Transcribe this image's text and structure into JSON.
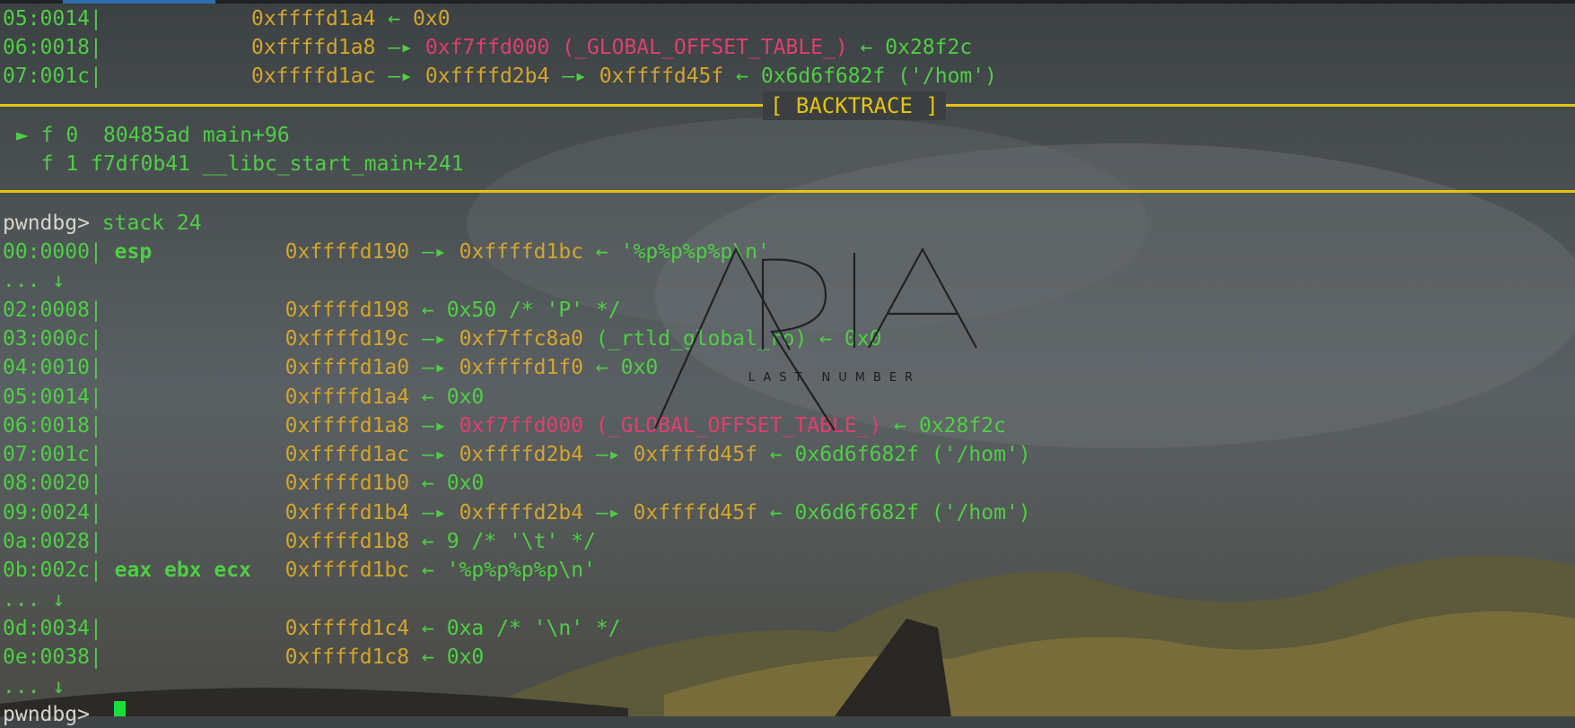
{
  "colors": {
    "background": "#3f4447",
    "offset_green": "#4ecf44",
    "address_yellow": "#d3a52e",
    "got_pink": "#df3f6e",
    "rule_yellow": "#e6c40a",
    "cursor_green": "#19e13a"
  },
  "top_telescope": [
    {
      "off": "05:0014",
      "addr": "0xffffd1a4",
      "a1": "←",
      "v1": "0x0"
    },
    {
      "off": "06:0018",
      "addr": "0xffffd1a8",
      "a1": "—▸",
      "v1": "0xf7ffd000",
      "v2": "(_GLOBAL_OFFSET_TABLE_)",
      "a2": "←",
      "v3": "0x28f2c"
    },
    {
      "off": "07:001c",
      "addr": "0xffffd1ac",
      "a1": "—▸",
      "v1": "0xffffd2b4",
      "a2": "—▸",
      "v2": "0xffffd45f",
      "a3": "←",
      "v3": "0x6d6f682f",
      "v4": "('/hom')"
    }
  ],
  "backtrace": {
    "label": "[ BACKTRACE ]",
    "frames": [
      {
        "marker": "►",
        "frame": "f 0",
        "addr": "80485ad",
        "sym": "main+96"
      },
      {
        "marker": "",
        "frame": "f 1",
        "addr": "f7df0b41",
        "sym": "__libc_start_main+241"
      }
    ]
  },
  "command": {
    "prompt": "pwndbg>",
    "text": "stack 24"
  },
  "stack": [
    {
      "off": "00:0000",
      "reg": "esp",
      "addr": "0xffffd190",
      "a1": "—▸",
      "v1": "0xffffd1bc",
      "a2": "←",
      "v2": "'%p%p%p%p\\n'"
    },
    {
      "skip": "... ↓"
    },
    {
      "off": "02:0008",
      "reg": "",
      "addr": "0xffffd198",
      "a1": "←",
      "v1": "0x50 /* 'P' */"
    },
    {
      "off": "03:000c",
      "reg": "",
      "addr": "0xffffd19c",
      "a1": "—▸",
      "v1": "0xf7ffc8a0",
      "v2": "(_rtld_global_ro)",
      "a2": "←",
      "v3": "0x0"
    },
    {
      "off": "04:0010",
      "reg": "",
      "addr": "0xffffd1a0",
      "a1": "—▸",
      "v1": "0xffffd1f0",
      "a2": "←",
      "v2": "0x0"
    },
    {
      "off": "05:0014",
      "reg": "",
      "addr": "0xffffd1a4",
      "a1": "←",
      "v1": "0x0"
    },
    {
      "off": "06:0018",
      "reg": "",
      "addr": "0xffffd1a8",
      "a1": "—▸",
      "v1": "0xf7ffd000",
      "v2": "(_GLOBAL_OFFSET_TABLE_)",
      "a2": "←",
      "v3": "0x28f2c"
    },
    {
      "off": "07:001c",
      "reg": "",
      "addr": "0xffffd1ac",
      "a1": "—▸",
      "v1": "0xffffd2b4",
      "a2": "—▸",
      "v2": "0xffffd45f",
      "a3": "←",
      "v3": "0x6d6f682f",
      "v4": "('/hom')"
    },
    {
      "off": "08:0020",
      "reg": "",
      "addr": "0xffffd1b0",
      "a1": "←",
      "v1": "0x0"
    },
    {
      "off": "09:0024",
      "reg": "",
      "addr": "0xffffd1b4",
      "a1": "—▸",
      "v1": "0xffffd2b4",
      "a2": "—▸",
      "v2": "0xffffd45f",
      "a3": "←",
      "v3": "0x6d6f682f",
      "v4": "('/hom')"
    },
    {
      "off": "0a:0028",
      "reg": "",
      "addr": "0xffffd1b8",
      "a1": "←",
      "v1": "9 /* '\\t' */"
    },
    {
      "off": "0b:002c",
      "reg": "eax ebx ecx",
      "addr": "0xffffd1bc",
      "a1": "←",
      "v1": "'%p%p%p%p\\n'"
    },
    {
      "skip": "... ↓"
    },
    {
      "off": "0d:0034",
      "reg": "",
      "addr": "0xffffd1c4",
      "a1": "←",
      "v1": "0xa /* '\\n' */"
    },
    {
      "off": "0e:0038",
      "reg": "",
      "addr": "0xffffd1c8",
      "a1": "←",
      "v1": "0x0"
    },
    {
      "skip": "... ↓"
    }
  ],
  "prompt_final": "pwndbg>",
  "watermark": {
    "title": "ARIA",
    "subtitle": "LAST NUMBER"
  }
}
